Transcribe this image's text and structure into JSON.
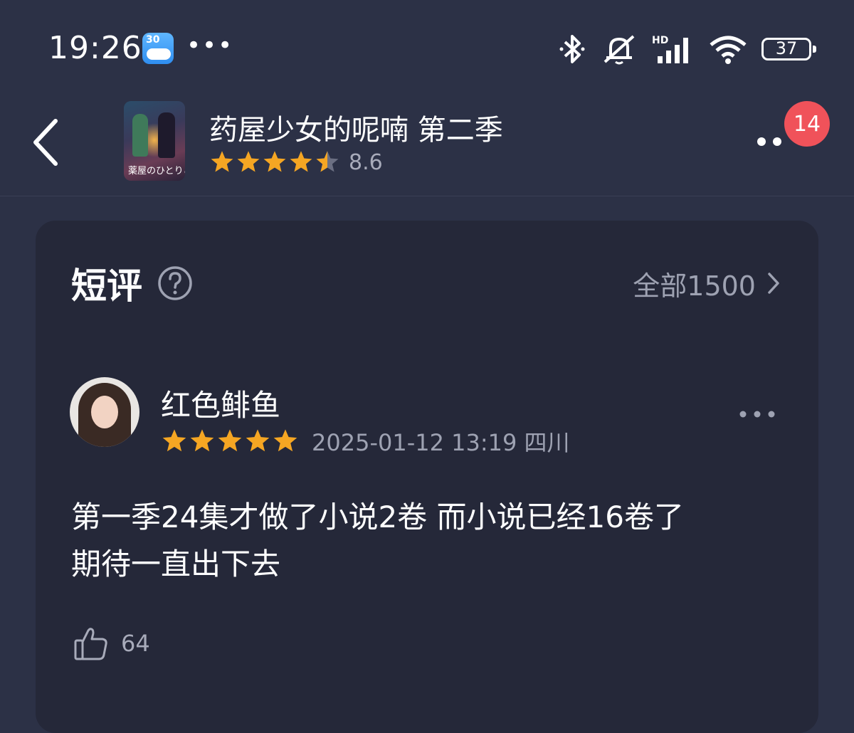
{
  "status_bar": {
    "time": "19:26",
    "weather_temp": "30",
    "more_dots": "•••",
    "battery": "37",
    "icons": [
      "bluetooth-icon",
      "mute-icon",
      "hd-signal-icon",
      "wifi-icon",
      "battery-icon"
    ]
  },
  "header": {
    "title": "药屋少女的呢喃 第二季",
    "rating": "8.6",
    "rating_stars": 4.5,
    "poster_text": "薬屋のひとりごと",
    "notification_count": "14"
  },
  "reviews_section": {
    "title": "短评",
    "all_link": "全部1500"
  },
  "review": {
    "username": "红色鲱鱼",
    "stars": 5,
    "datetime_location": "2025-01-12 13:19 四川",
    "lines": [
      "第一季24集才做了小说2卷 而小说已经16卷了",
      "期待一直出下去"
    ],
    "likes": "64"
  },
  "colors": {
    "background": "#2c3146",
    "card": "#252839",
    "star": "#f5a623",
    "badge": "#f0525a",
    "muted_text": "#9ea2b2"
  }
}
